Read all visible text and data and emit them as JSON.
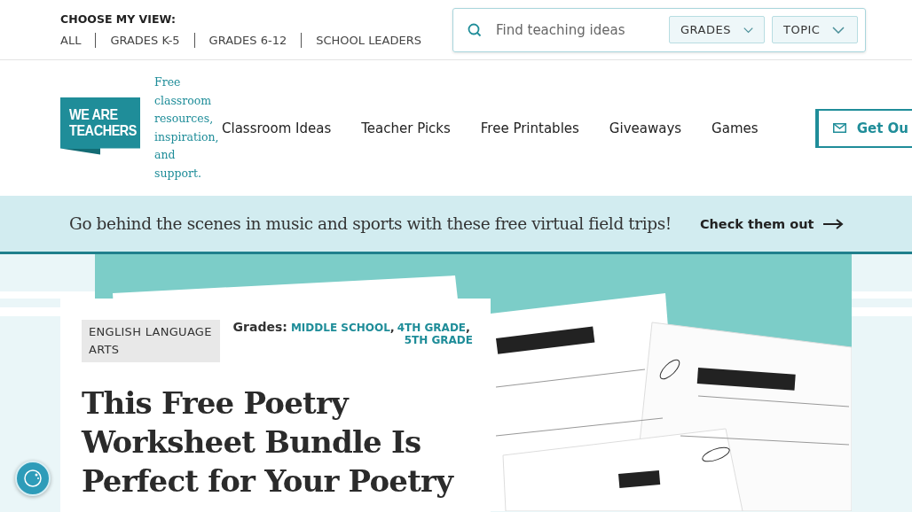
{
  "top_bar": {
    "heading": "CHOOSE MY VIEW:",
    "views": [
      "ALL",
      "GRADES K-5",
      "GRADES 6-12",
      "SCHOOL LEADERS"
    ]
  },
  "search": {
    "placeholder": "Find teaching ideas",
    "filters": [
      "GRADES",
      "TOPIC"
    ]
  },
  "header": {
    "logo": [
      "WE ARE",
      "TEACHERS"
    ],
    "tagline": "Free classroom resources, inspiration, and support.",
    "nav": [
      "Classroom Ideas",
      "Teacher Picks",
      "Free Printables",
      "Giveaways",
      "Games"
    ],
    "cta": "Get Ou"
  },
  "banner": {
    "text": "Go behind the scenes in music and sports with these free virtual field trips!",
    "link": "Check them out"
  },
  "article": {
    "category": "ENGLISH LANGUAGE ARTS",
    "grades_label": "Grades:",
    "grades": [
      "MIDDLE SCHOOL",
      "4TH GRADE",
      "5TH GRADE"
    ],
    "grade_separator": ",",
    "title": "This Free Poetry Worksheet Bundle Is Perfect for Your Poetry",
    "hero_image": {
      "kind": "picture"
    }
  }
}
